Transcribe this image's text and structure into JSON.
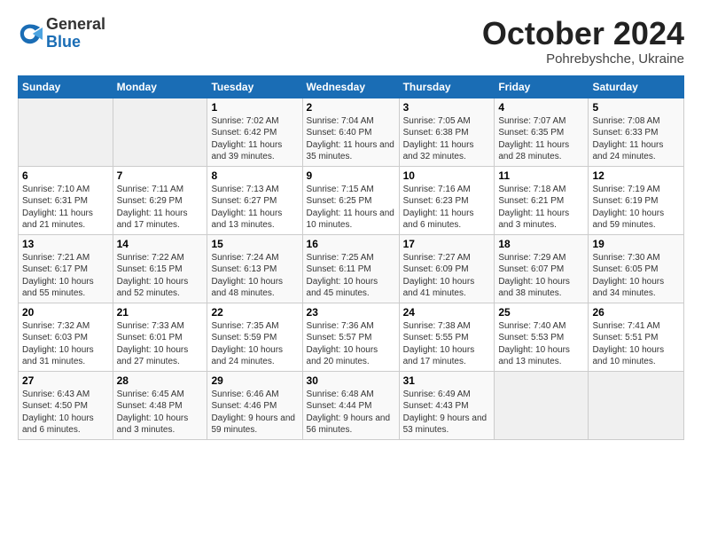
{
  "header": {
    "logo_line1": "General",
    "logo_line2": "Blue",
    "month": "October 2024",
    "location": "Pohrebyshche, Ukraine"
  },
  "days_of_week": [
    "Sunday",
    "Monday",
    "Tuesday",
    "Wednesday",
    "Thursday",
    "Friday",
    "Saturday"
  ],
  "weeks": [
    [
      {
        "num": "",
        "content": ""
      },
      {
        "num": "",
        "content": ""
      },
      {
        "num": "1",
        "content": "Sunrise: 7:02 AM\nSunset: 6:42 PM\nDaylight: 11 hours and 39 minutes."
      },
      {
        "num": "2",
        "content": "Sunrise: 7:04 AM\nSunset: 6:40 PM\nDaylight: 11 hours and 35 minutes."
      },
      {
        "num": "3",
        "content": "Sunrise: 7:05 AM\nSunset: 6:38 PM\nDaylight: 11 hours and 32 minutes."
      },
      {
        "num": "4",
        "content": "Sunrise: 7:07 AM\nSunset: 6:35 PM\nDaylight: 11 hours and 28 minutes."
      },
      {
        "num": "5",
        "content": "Sunrise: 7:08 AM\nSunset: 6:33 PM\nDaylight: 11 hours and 24 minutes."
      }
    ],
    [
      {
        "num": "6",
        "content": "Sunrise: 7:10 AM\nSunset: 6:31 PM\nDaylight: 11 hours and 21 minutes."
      },
      {
        "num": "7",
        "content": "Sunrise: 7:11 AM\nSunset: 6:29 PM\nDaylight: 11 hours and 17 minutes."
      },
      {
        "num": "8",
        "content": "Sunrise: 7:13 AM\nSunset: 6:27 PM\nDaylight: 11 hours and 13 minutes."
      },
      {
        "num": "9",
        "content": "Sunrise: 7:15 AM\nSunset: 6:25 PM\nDaylight: 11 hours and 10 minutes."
      },
      {
        "num": "10",
        "content": "Sunrise: 7:16 AM\nSunset: 6:23 PM\nDaylight: 11 hours and 6 minutes."
      },
      {
        "num": "11",
        "content": "Sunrise: 7:18 AM\nSunset: 6:21 PM\nDaylight: 11 hours and 3 minutes."
      },
      {
        "num": "12",
        "content": "Sunrise: 7:19 AM\nSunset: 6:19 PM\nDaylight: 10 hours and 59 minutes."
      }
    ],
    [
      {
        "num": "13",
        "content": "Sunrise: 7:21 AM\nSunset: 6:17 PM\nDaylight: 10 hours and 55 minutes."
      },
      {
        "num": "14",
        "content": "Sunrise: 7:22 AM\nSunset: 6:15 PM\nDaylight: 10 hours and 52 minutes."
      },
      {
        "num": "15",
        "content": "Sunrise: 7:24 AM\nSunset: 6:13 PM\nDaylight: 10 hours and 48 minutes."
      },
      {
        "num": "16",
        "content": "Sunrise: 7:25 AM\nSunset: 6:11 PM\nDaylight: 10 hours and 45 minutes."
      },
      {
        "num": "17",
        "content": "Sunrise: 7:27 AM\nSunset: 6:09 PM\nDaylight: 10 hours and 41 minutes."
      },
      {
        "num": "18",
        "content": "Sunrise: 7:29 AM\nSunset: 6:07 PM\nDaylight: 10 hours and 38 minutes."
      },
      {
        "num": "19",
        "content": "Sunrise: 7:30 AM\nSunset: 6:05 PM\nDaylight: 10 hours and 34 minutes."
      }
    ],
    [
      {
        "num": "20",
        "content": "Sunrise: 7:32 AM\nSunset: 6:03 PM\nDaylight: 10 hours and 31 minutes."
      },
      {
        "num": "21",
        "content": "Sunrise: 7:33 AM\nSunset: 6:01 PM\nDaylight: 10 hours and 27 minutes."
      },
      {
        "num": "22",
        "content": "Sunrise: 7:35 AM\nSunset: 5:59 PM\nDaylight: 10 hours and 24 minutes."
      },
      {
        "num": "23",
        "content": "Sunrise: 7:36 AM\nSunset: 5:57 PM\nDaylight: 10 hours and 20 minutes."
      },
      {
        "num": "24",
        "content": "Sunrise: 7:38 AM\nSunset: 5:55 PM\nDaylight: 10 hours and 17 minutes."
      },
      {
        "num": "25",
        "content": "Sunrise: 7:40 AM\nSunset: 5:53 PM\nDaylight: 10 hours and 13 minutes."
      },
      {
        "num": "26",
        "content": "Sunrise: 7:41 AM\nSunset: 5:51 PM\nDaylight: 10 hours and 10 minutes."
      }
    ],
    [
      {
        "num": "27",
        "content": "Sunrise: 6:43 AM\nSunset: 4:50 PM\nDaylight: 10 hours and 6 minutes."
      },
      {
        "num": "28",
        "content": "Sunrise: 6:45 AM\nSunset: 4:48 PM\nDaylight: 10 hours and 3 minutes."
      },
      {
        "num": "29",
        "content": "Sunrise: 6:46 AM\nSunset: 4:46 PM\nDaylight: 9 hours and 59 minutes."
      },
      {
        "num": "30",
        "content": "Sunrise: 6:48 AM\nSunset: 4:44 PM\nDaylight: 9 hours and 56 minutes."
      },
      {
        "num": "31",
        "content": "Sunrise: 6:49 AM\nSunset: 4:43 PM\nDaylight: 9 hours and 53 minutes."
      },
      {
        "num": "",
        "content": ""
      },
      {
        "num": "",
        "content": ""
      }
    ]
  ]
}
